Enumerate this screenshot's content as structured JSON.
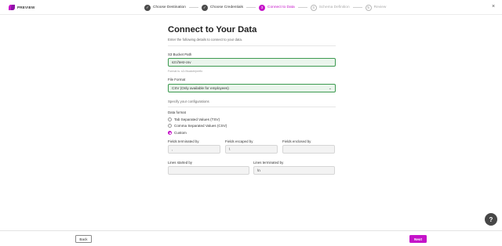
{
  "brand": {
    "name": "PREVIEW",
    "accent": "#c513c9"
  },
  "steps": [
    {
      "label": "Choose Destination",
      "state": "done",
      "icon": "check-icon"
    },
    {
      "label": "Choose Credentials",
      "state": "done",
      "icon": "check-icon"
    },
    {
      "label": "Connect to Data",
      "state": "current",
      "number": "3"
    },
    {
      "label": "Schema Definition",
      "state": "todo",
      "number": "4"
    },
    {
      "label": "Review",
      "state": "todo",
      "number": "5"
    }
  ],
  "close_icon": "close-icon",
  "main": {
    "title": "Connect to Your Data",
    "subtitle": "Enter the following details to connect to your data.",
    "bucket_label": "S3 Bucket Path",
    "bucket_value": "s3://test-csv",
    "bucket_hint": "Format is: s3://bucket/prefix",
    "format_label": "File Format",
    "format_value": "CSV (Only available for employees)",
    "config_heading": "Specify your configurations",
    "data_format_label": "Data format",
    "radio_options": [
      {
        "label": "Tab Separated Values (TSV)",
        "checked": false
      },
      {
        "label": "Comma Separated Values (CSV)",
        "checked": false
      },
      {
        "label": "Custom",
        "checked": true
      }
    ],
    "fields_terminated_label": "Fields terminated by",
    "fields_terminated_value": ",",
    "fields_escaped_label": "Fields escaped by",
    "fields_escaped_value": "\\",
    "fields_enclosed_label": "Fields enclosed by",
    "fields_enclosed_value": "",
    "lines_started_label": "Lines started by",
    "lines_started_value": "",
    "lines_terminated_label": "Lines terminated by",
    "lines_terminated_value": "\\n"
  },
  "help_label": "?",
  "footer": {
    "back_label": "Back",
    "next_label": "Next"
  }
}
